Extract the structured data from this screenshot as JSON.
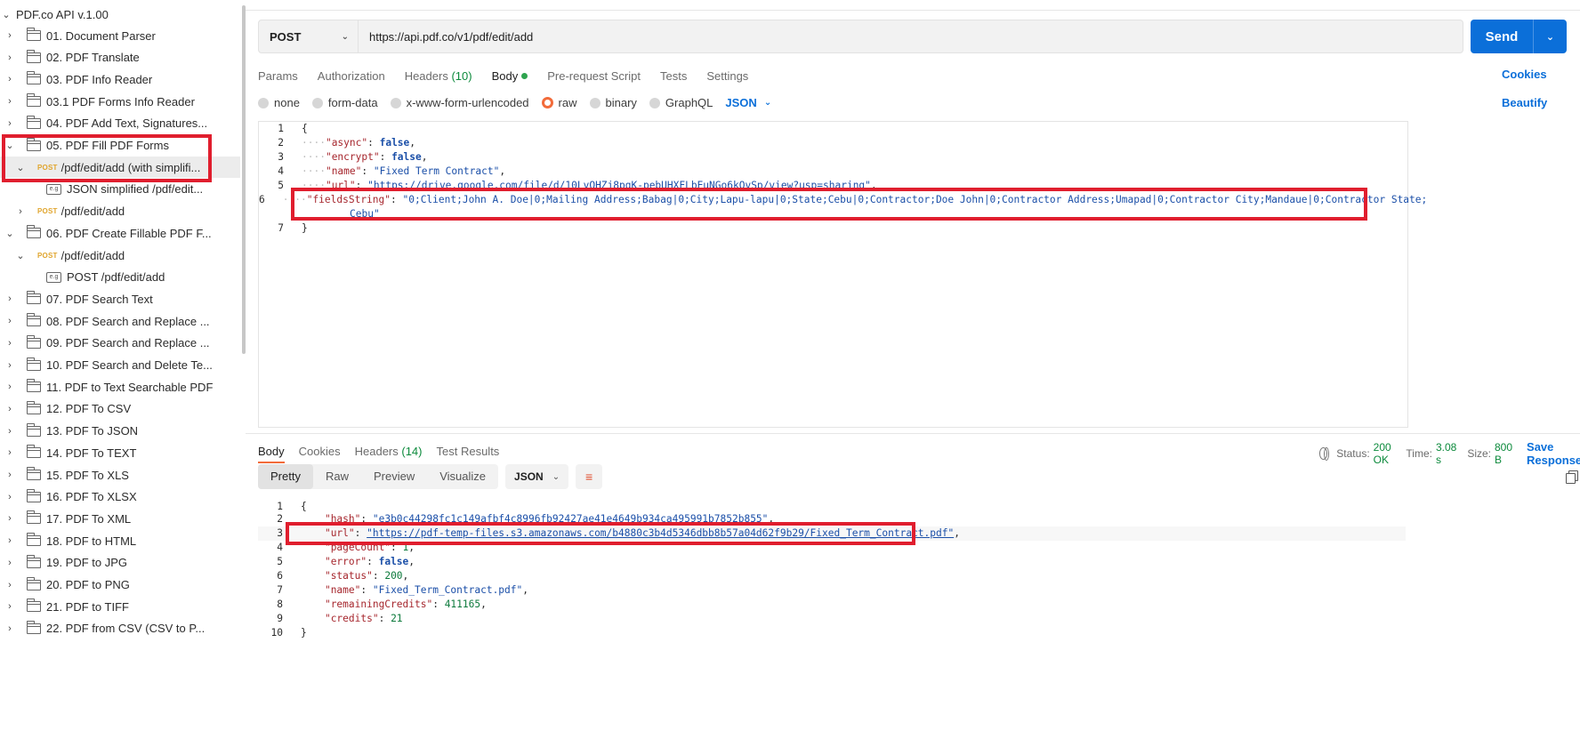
{
  "sidebar": {
    "root": "PDF.co API v.1.00",
    "items": [
      {
        "kind": "folder",
        "label": "01. Document Parser"
      },
      {
        "kind": "folder",
        "label": "02. PDF Translate"
      },
      {
        "kind": "folder",
        "label": "03. PDF Info Reader"
      },
      {
        "kind": "folder",
        "label": "03.1 PDF Forms Info Reader"
      },
      {
        "kind": "folder",
        "label": "04. PDF Add Text, Signatures..."
      },
      {
        "kind": "folder",
        "label": "05. PDF Fill PDF Forms"
      },
      {
        "kind": "request",
        "method": "POST",
        "label": "/pdf/edit/add (with simplifi..."
      },
      {
        "kind": "example",
        "label": "JSON simplified /pdf/edit..."
      },
      {
        "kind": "request",
        "method": "POST",
        "label": "/pdf/edit/add"
      },
      {
        "kind": "folder",
        "label": "06. PDF Create Fillable PDF F..."
      },
      {
        "kind": "request",
        "method": "POST",
        "label": "/pdf/edit/add"
      },
      {
        "kind": "example",
        "label": "POST /pdf/edit/add"
      },
      {
        "kind": "folder",
        "label": "07. PDF Search Text"
      },
      {
        "kind": "folder",
        "label": "08. PDF Search and Replace ..."
      },
      {
        "kind": "folder",
        "label": "09. PDF Search and Replace ..."
      },
      {
        "kind": "folder",
        "label": "10. PDF Search and Delete Te..."
      },
      {
        "kind": "folder",
        "label": "11. PDF to Text Searchable PDF"
      },
      {
        "kind": "folder",
        "label": "12. PDF To CSV"
      },
      {
        "kind": "folder",
        "label": "13. PDF To JSON"
      },
      {
        "kind": "folder",
        "label": "14. PDF To TEXT"
      },
      {
        "kind": "folder",
        "label": "15. PDF To XLS"
      },
      {
        "kind": "folder",
        "label": "16. PDF To XLSX"
      },
      {
        "kind": "folder",
        "label": "17. PDF To XML"
      },
      {
        "kind": "folder",
        "label": "18. PDF to HTML"
      },
      {
        "kind": "folder",
        "label": "19. PDF to JPG"
      },
      {
        "kind": "folder",
        "label": "20. PDF to PNG"
      },
      {
        "kind": "folder",
        "label": "21. PDF to TIFF"
      },
      {
        "kind": "folder",
        "label": "22. PDF from CSV (CSV to P..."
      }
    ]
  },
  "request": {
    "method": "POST",
    "url": "https://api.pdf.co/v1/pdf/edit/add",
    "send_label": "Send",
    "tabs": {
      "params": "Params",
      "authorization": "Authorization",
      "headers": "Headers",
      "headers_count": "(10)",
      "body": "Body",
      "prerequest": "Pre-request Script",
      "tests": "Tests",
      "settings": "Settings"
    },
    "cookies_link": "Cookies",
    "body_types": {
      "none": "none",
      "form_data": "form-data",
      "urlencoded": "x-www-form-urlencoded",
      "raw": "raw",
      "binary": "binary",
      "graphql": "GraphQL",
      "format": "JSON"
    },
    "beautify_link": "Beautify",
    "body_lines": {
      "l1": "{",
      "l2_key": "\"async\"",
      "l2_val": "false",
      "l3_key": "\"encrypt\"",
      "l3_val": "false",
      "l4_key": "\"name\"",
      "l4_val": "\"Fixed Term Contract\"",
      "l5_key": "\"url\"",
      "l5_val": "\"https://drive.google.com/file/d/10LvQHZj8pgK-pebUHXFLbEuNGo6kOvSp/view?usp=sharing\"",
      "l6_key": "\"fieldsString\"",
      "l6_val": "\"0;Client;John A. Doe|0;Mailing Address;Babag|0;City;Lapu-lapu|0;State;Cebu|0;Contractor;Doe John|0;Contractor Address;Umapad|0;Contractor City;Mandaue|0;Contractor State;",
      "l6_cont": "Cebu\"",
      "l7": "}"
    }
  },
  "response": {
    "tabs": {
      "body": "Body",
      "cookies": "Cookies",
      "headers": "Headers",
      "headers_count": "(14)",
      "test_results": "Test Results"
    },
    "status_label": "Status:",
    "status_value": "200 OK",
    "time_label": "Time:",
    "time_value": "3.08 s",
    "size_label": "Size:",
    "size_value": "800 B",
    "save_label": "Save Response",
    "views": {
      "pretty": "Pretty",
      "raw": "Raw",
      "preview": "Preview",
      "visualize": "Visualize"
    },
    "format": "JSON",
    "lines": {
      "l1": "{",
      "l2_key": "\"hash\"",
      "l2_val": "\"e3b0c44298fc1c149afbf4c8996fb92427ae41e4649b934ca495991b7852b855\"",
      "l3_key": "\"url\"",
      "l3_val": "\"https://pdf-temp-files.s3.amazonaws.com/b4880c3b4d5346dbb8b57a04d62f9b29/Fixed_Term_Contract.pdf\"",
      "l4_key": "\"pageCount\"",
      "l4_val": "1",
      "l5_key": "\"error\"",
      "l5_val": "false",
      "l6_key": "\"status\"",
      "l6_val": "200",
      "l7_key": "\"name\"",
      "l7_val": "\"Fixed_Term_Contract.pdf\"",
      "l8_key": "\"remainingCredits\"",
      "l8_val": "411165",
      "l9_key": "\"credits\"",
      "l9_val": "21",
      "l10": "}"
    }
  },
  "colors": {
    "accent": "#0b6fd9",
    "highlight_box": "#e01e2e",
    "post_method": "#e0a52e",
    "success": "#0c8a3c",
    "active_tab": "#f26b3a"
  }
}
